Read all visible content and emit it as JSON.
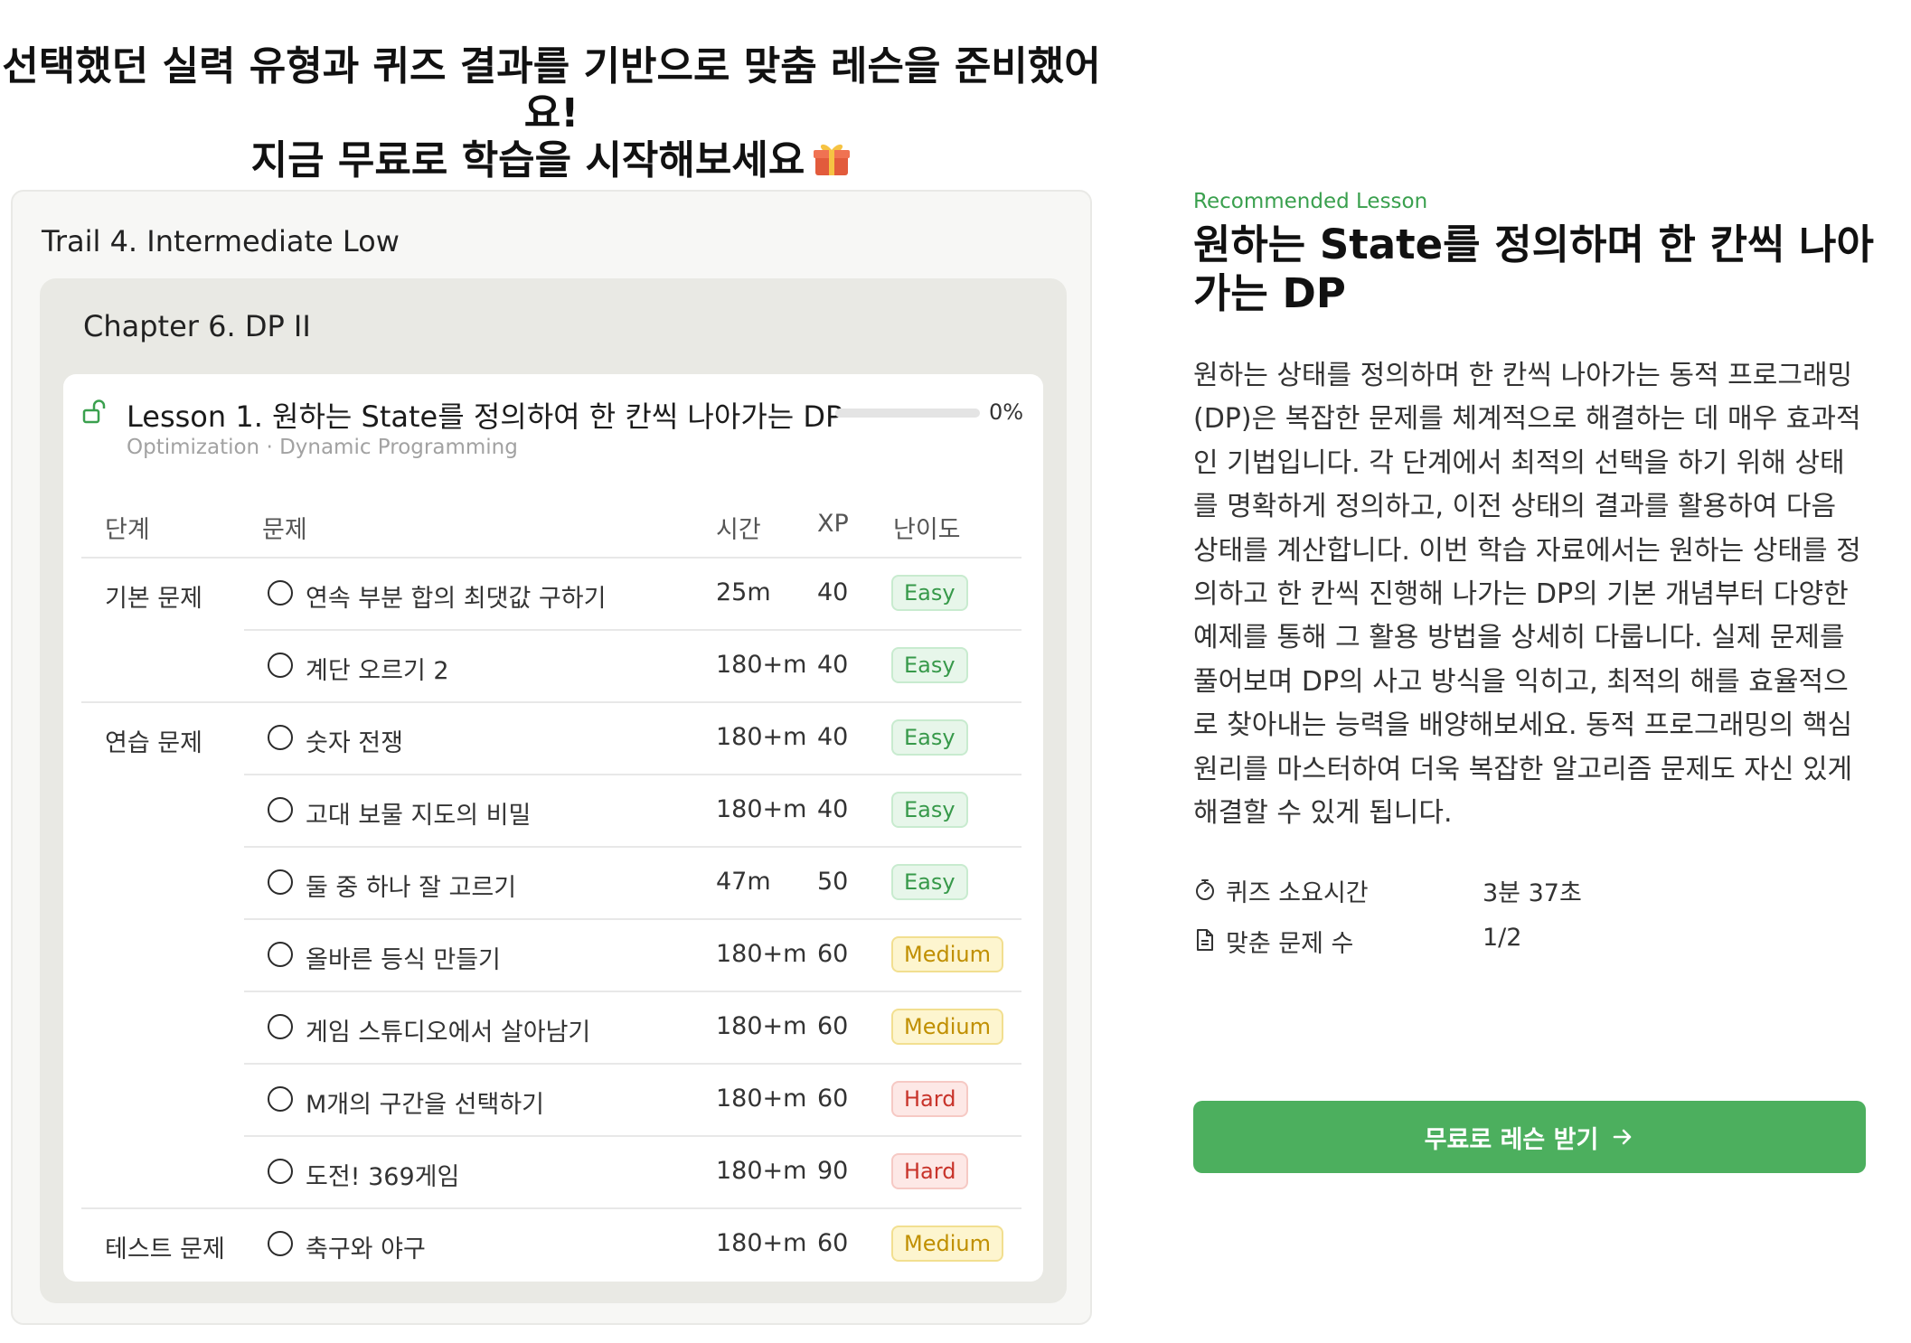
{
  "headline": {
    "line1": "선택했던 실력 유형과 퀴즈 결과를 기반으로 맞춤 레슨을 준비했어요!",
    "line2": "지금 무료로 학습을 시작해보세요",
    "icon": "gift-icon"
  },
  "trail": {
    "title": "Trail 4. Intermediate Low",
    "chapter": {
      "title": "Chapter 6. DP II",
      "lesson": {
        "title": "Lesson 1. 원하는 State를 정의하여 한 칸씩 나아가는 DP",
        "subtitle": "Optimization · Dynamic Programming",
        "progress_value": 0,
        "progress_text": "0%",
        "icon": "unlock-icon",
        "columns": [
          "단계",
          "문제",
          "시간",
          "XP",
          "난이도"
        ],
        "rows": [
          {
            "stage": "기본 문제",
            "name": "연속 부분 합의 최댓값 구하기",
            "time": "25m",
            "xp": "40",
            "level": "Easy"
          },
          {
            "stage": "",
            "name": "계단 오르기 2",
            "time": "180+m",
            "xp": "40",
            "level": "Easy"
          },
          {
            "stage": "연습 문제",
            "name": "숫자 전쟁",
            "time": "180+m",
            "xp": "40",
            "level": "Easy"
          },
          {
            "stage": "",
            "name": "고대 보물 지도의 비밀",
            "time": "180+m",
            "xp": "40",
            "level": "Easy"
          },
          {
            "stage": "",
            "name": "둘 중 하나 잘 고르기",
            "time": "47m",
            "xp": "50",
            "level": "Easy"
          },
          {
            "stage": "",
            "name": "올바른 등식 만들기",
            "time": "180+m",
            "xp": "60",
            "level": "Medium"
          },
          {
            "stage": "",
            "name": "게임 스튜디오에서 살아남기",
            "time": "180+m",
            "xp": "60",
            "level": "Medium"
          },
          {
            "stage": "",
            "name": "M개의 구간을 선택하기",
            "time": "180+m",
            "xp": "60",
            "level": "Hard"
          },
          {
            "stage": "",
            "name": "도전! 369게임",
            "time": "180+m",
            "xp": "90",
            "level": "Hard"
          },
          {
            "stage": "테스트 문제",
            "name": "축구와 야구",
            "time": "180+m",
            "xp": "60",
            "level": "Medium"
          }
        ]
      }
    }
  },
  "recommend": {
    "label": "Recommended Lesson",
    "title": "원하는 State를 정의하며 한 칸씩 나아가는 DP",
    "description": "원하는 상태를 정의하며 한 칸씩 나아가는 동적 프로그래밍(DP)은 복잡한 문제를 체계적으로 해결하는 데 매우 효과적인 기법입니다. 각 단계에서 최적의 선택을 하기 위해 상태를 명확하게 정의하고, 이전 상태의 결과를 활용하여 다음 상태를 계산합니다. 이번 학습 자료에서는 원하는 상태를 정의하고 한 칸씩 진행해 나가는 DP의 기본 개념부터 다양한 예제를 통해 그 활용 방법을 상세히 다룹니다. 실제 문제를 풀어보며 DP의 사고 방식을 익히고, 최적의 해를 효율적으로 찾아내는 능력을 배양해보세요. 동적 프로그래밍의 핵심 원리를 마스터하여 더욱 복잡한 알고리즘 문제도 자신 있게 해결할 수 있게 됩니다.",
    "quiz_time_label": "퀴즈 소요시간",
    "quiz_time_value": "3분 37초",
    "correct_label": "맞춘 문제 수",
    "correct_value": "1/2",
    "cta_label": "무료로 레슨 받기"
  },
  "colors": {
    "accent": "#4caf5e",
    "easy": "#37994a",
    "medium": "#c08f00",
    "hard": "#c8332a"
  }
}
